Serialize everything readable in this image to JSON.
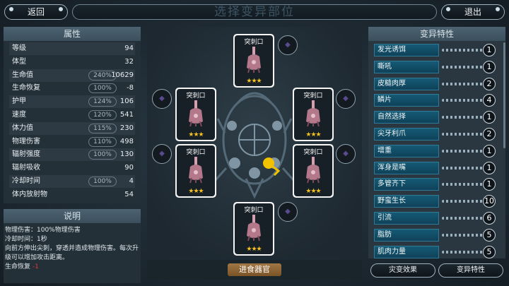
{
  "top": {
    "back_label": "返回",
    "title": "选择变异部位",
    "exit_label": "退出"
  },
  "attributes": {
    "header": "属性",
    "rows": [
      {
        "label": "等级",
        "pct": "",
        "value": "94"
      },
      {
        "label": "体型",
        "pct": "",
        "value": "32"
      },
      {
        "label": "生命值",
        "pct": "240%",
        "value": "10629"
      },
      {
        "label": "生命恢复",
        "pct": "100%",
        "value": "-8"
      },
      {
        "label": "护甲",
        "pct": "124%",
        "value": "106"
      },
      {
        "label": "速度",
        "pct": "120%",
        "value": "541"
      },
      {
        "label": "体力值",
        "pct": "115%",
        "value": "230"
      },
      {
        "label": "物理伤害",
        "pct": "110%",
        "value": "498"
      },
      {
        "label": "辐射强度",
        "pct": "100%",
        "value": "130"
      },
      {
        "label": "辐射吸收",
        "pct": "",
        "value": "90"
      },
      {
        "label": "冷却时间",
        "pct": "100%",
        "value": "4"
      },
      {
        "label": "体内放射物",
        "pct": "",
        "value": "54"
      }
    ]
  },
  "description": {
    "header": "说明",
    "line1": "物理伤害：100%物理伤害",
    "line2": "冷却时间：1秒",
    "line3": "向前方伸出尖刺，穿透并造成物理伤害。每次升级可以增加攻击距离。",
    "line4_label": "生命恢复",
    "line4_value": "-1"
  },
  "organs": {
    "card_title": "突刺口",
    "stars": "★★★",
    "slot_icon": "mutation-gem-icon"
  },
  "feed_button": "进食器官",
  "traits": {
    "header": "变异特性",
    "items": [
      {
        "name": "发光诱饵",
        "level": "1"
      },
      {
        "name": "嘶吼",
        "level": "1"
      },
      {
        "name": "皮糙肉厚",
        "level": "2"
      },
      {
        "name": "鳞片",
        "level": "4"
      },
      {
        "name": "自然选择",
        "level": "1"
      },
      {
        "name": "尖牙利爪",
        "level": "2"
      },
      {
        "name": "增重",
        "level": "1"
      },
      {
        "name": "浑身是嘴",
        "level": "1"
      },
      {
        "name": "多管齐下",
        "level": "1"
      },
      {
        "name": "野蛮生长",
        "level": "10"
      },
      {
        "name": "引流",
        "level": "6"
      },
      {
        "name": "脂肪",
        "level": "5"
      },
      {
        "name": "肌肉力量",
        "level": "5"
      }
    ]
  },
  "bottom": {
    "disaster_label": "灾变效果",
    "trait_label": "变异特性"
  },
  "colors": {
    "accent_gold": "#f5c020",
    "trait_blue": "#155a75",
    "card_white": "#f6f6f6"
  }
}
